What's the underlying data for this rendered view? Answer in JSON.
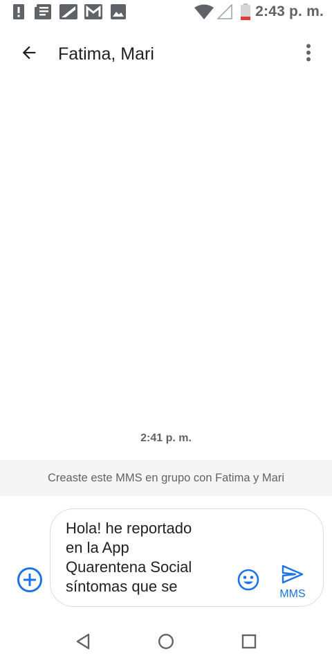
{
  "status_bar": {
    "time": "2:43 p. m.",
    "left_icons": [
      "alert-icon",
      "news-icon",
      "flipboard-icon",
      "gmail-icon",
      "gallery-icon"
    ],
    "right_icons": [
      "wifi-icon",
      "cellular-signal-icon",
      "battery-low-icon"
    ],
    "colors": {
      "icon": "#5f6368",
      "battery_low": "#e53935"
    }
  },
  "app_bar": {
    "title": "Fatima, Mari",
    "back_icon": "arrow-back-icon",
    "menu_icon": "more-vert-icon"
  },
  "conversation": {
    "timestamp": "2:41 p. m.",
    "info_text": "Creaste este MMS en grupo con Fatima y Mari"
  },
  "composer": {
    "text": "Hola! he reportado\nen la App\nQuarentena Social\nsíntomas que se",
    "send_label": "MMS",
    "add_icon": "add-circle-icon",
    "emoji_icon": "emoji-icon",
    "send_icon": "send-icon",
    "accent_color": "#1a73e8"
  },
  "nav_bar": {
    "icons": [
      "back-triangle-icon",
      "home-circle-icon",
      "recents-square-icon"
    ]
  }
}
